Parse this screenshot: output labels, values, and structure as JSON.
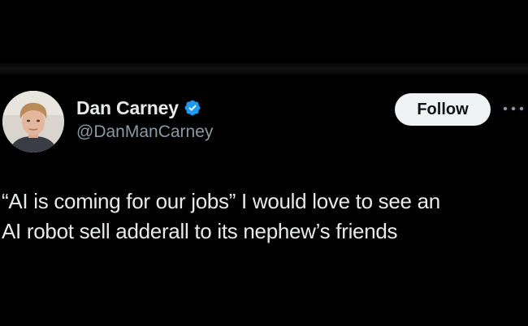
{
  "tweet": {
    "author": {
      "display_name": "Dan Carney",
      "handle": "@DanManCarney",
      "verified": true,
      "verified_color": "#1d9bf0",
      "avatar_icon": "profile-photo"
    },
    "follow_label": "Follow",
    "more_icon": "ellipsis-icon",
    "text_lines": [
      "“AI is coming for our jobs” I would love to see an",
      "AI robot sell adderall to its nephew’s friends"
    ]
  },
  "theme": {
    "background": "#000000",
    "text": "#e7e9ea",
    "secondary_text": "#8b98a5",
    "button_bg": "#eff3f4"
  }
}
